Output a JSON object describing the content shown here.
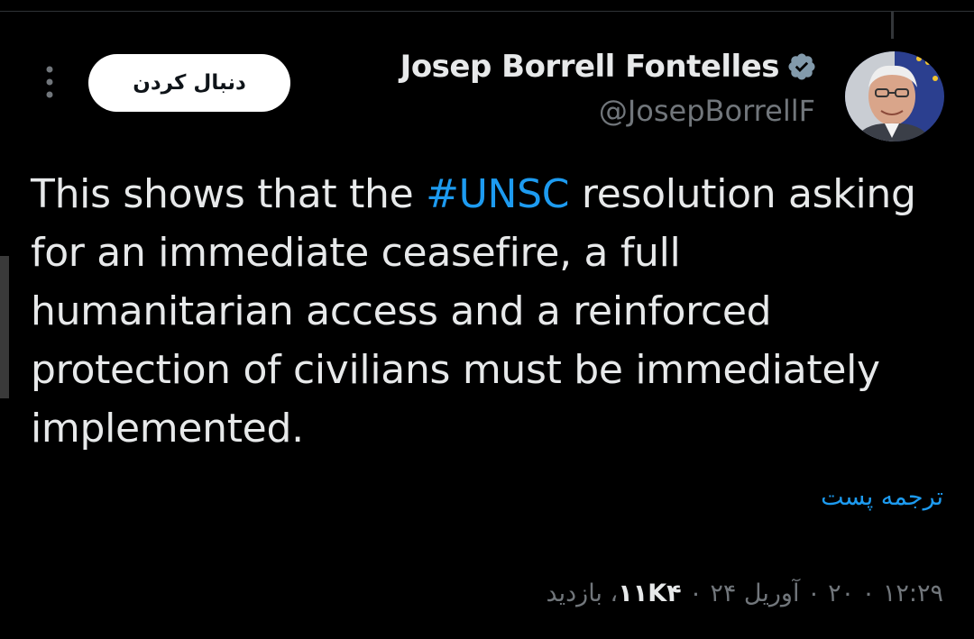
{
  "author": {
    "display_name": "Josep Borrell Fontelles",
    "handle": "@JosepBorrellF",
    "verified": true,
    "avatar_icon": "profile-photo"
  },
  "actions": {
    "follow_label": "دنبال کردن",
    "more_icon": "more-vertical-icon"
  },
  "tweet": {
    "text_before": "This shows that the ",
    "hashtag": "#UNSC",
    "text_after": " resolution asking for an immediate ceasefire, a full humanitarian access and a reinforced protection of civilians must be immediately implemented."
  },
  "translate_label": "ترجمه پست",
  "meta": {
    "timestamp": "۱۲:۲۹ ۰ ۲۰ ۰ آوریل ۲۴ ۰",
    "views_count": "۱۱K۴",
    "views_label": "، بازدید"
  },
  "colors": {
    "background": "#000000",
    "text": "#e7e9ea",
    "secondary_text": "#71767b",
    "link": "#1d9bf0",
    "verified_badge": "#829aab",
    "follow_bg": "#ffffff"
  }
}
